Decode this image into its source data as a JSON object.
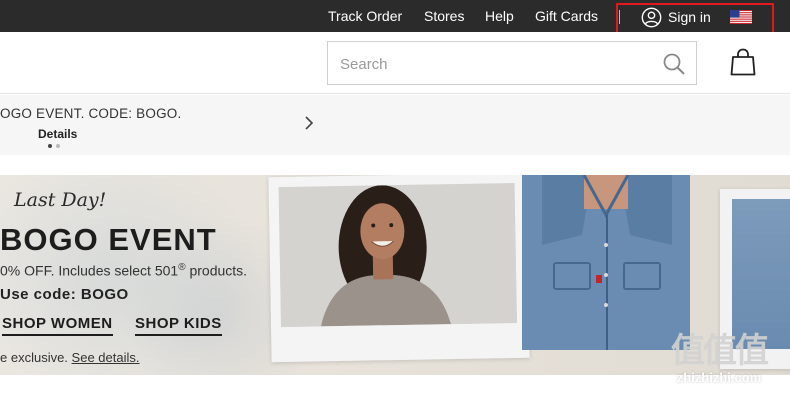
{
  "topbar": {
    "links": {
      "track_order": "Track Order",
      "stores": "Stores",
      "help": "Help",
      "gift_cards": "Gift Cards"
    },
    "sign_in": "Sign in",
    "flag_icon": "us-flag-icon",
    "background_color": "#2b2b2b",
    "highlight_color": "#e0191f"
  },
  "header": {
    "search_placeholder": "Search",
    "search_icon": "search-icon",
    "bag_icon": "shopping-bag-icon"
  },
  "promo": {
    "text": "OGO EVENT. CODE: BOGO.",
    "details_label": "Details",
    "slide_count": 2,
    "active_slide": 1
  },
  "hero": {
    "eyebrow": "Last Day!",
    "headline": "BOGO EVENT",
    "subline_before": "0% OFF. Includes select 501",
    "subline_reg": "®",
    "subline_after": " products.",
    "code_line": "Use code: BOGO",
    "cta_women": "SHOP WOMEN",
    "cta_kids": "SHOP KIDS",
    "fine_print_before": "e exclusive. ",
    "fine_print_link": "See details."
  },
  "watermark": {
    "logo": "值值值",
    "text": "zhizhizhi.com"
  }
}
